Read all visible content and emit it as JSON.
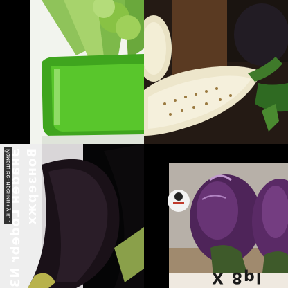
{
  "tiles": {
    "bottom_left": {
      "vertical_line_1": "Вонзержх",
      "vertical_line_2": "Энаdeн Lodebr N3",
      "small_caption": "Йомощ Вениренинк у к..."
    },
    "bottom_right": {
      "banner_text": "Iq8 X"
    }
  },
  "colors": {
    "juice_green": "#58c72d",
    "celery_green": "#94c653",
    "eggplant_purple": "#5a2a66",
    "eggplant_flesh": "#efe7cf",
    "background": "#000000"
  }
}
